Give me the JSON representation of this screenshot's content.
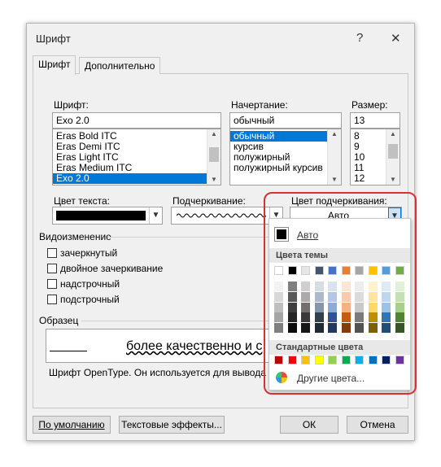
{
  "dialog": {
    "title": "Шрифт",
    "help": "?",
    "close": "✕"
  },
  "tabs": [
    {
      "label": "Шрифт"
    },
    {
      "label": "Дополнительно"
    }
  ],
  "font": {
    "label": "Шрифт:",
    "value": "Exo 2.0",
    "items": [
      "Eras Bold ITC",
      "Eras Demi ITC",
      "Eras Light ITC",
      "Eras Medium ITC",
      "Exo 2.0"
    ],
    "selected": "Exo 2.0"
  },
  "style": {
    "label": "Начертание:",
    "value": "обычный",
    "items": [
      "обычный",
      "курсив",
      "полужирный",
      "полужирный курсив"
    ],
    "selected": "обычный"
  },
  "size": {
    "label": "Размер:",
    "value": "13",
    "items": [
      "8",
      "9",
      "10",
      "11",
      "12"
    ]
  },
  "text_color": {
    "label": "Цвет текста:",
    "value_color": "#000000"
  },
  "underline": {
    "label": "Подчеркивание:"
  },
  "underline_color": {
    "label": "Цвет подчеркивания:",
    "value": "Авто"
  },
  "effects": {
    "heading": "Видоизменение",
    "items": [
      "зачеркнутый",
      "двойное зачеркивание",
      "надстрочный",
      "подстрочный"
    ]
  },
  "sample": {
    "heading": "Образец",
    "preview_text": "более качественно и с",
    "note": "Шрифт OpenType. Он используется для вывода ка"
  },
  "buttons": {
    "default": "По умолчанию",
    "text_effects": "Текстовые эффекты...",
    "ok": "ОК",
    "cancel": "Отмена"
  },
  "color_popup": {
    "auto_label": "Авто",
    "theme_heading": "Цвета темы",
    "standard_heading": "Стандартные цвета",
    "more_colors": "Другие цвета...",
    "theme_top": [
      "#ffffff",
      "#000000",
      "#e7e6e6",
      "#44546a",
      "#4472c4",
      "#ed7d31",
      "#a5a5a5",
      "#ffc000",
      "#5b9bd5",
      "#70ad47"
    ],
    "theme_shades": [
      [
        "#f2f2f2",
        "#7f7f7f",
        "#d0cece",
        "#d6dce4",
        "#d9e2f3",
        "#fbe5d5",
        "#ededed",
        "#fff2cc",
        "#deebf6",
        "#e2efd9"
      ],
      [
        "#d8d8d8",
        "#595959",
        "#aeaaaa",
        "#adb9ca",
        "#b4c6e7",
        "#f7cbac",
        "#dbdbdb",
        "#fee599",
        "#bdd7ee",
        "#c5e0b3"
      ],
      [
        "#bfbfbf",
        "#3f3f3f",
        "#757070",
        "#8496b0",
        "#8eaadb",
        "#f4b183",
        "#c9c9c9",
        "#ffd965",
        "#9cc3e5",
        "#a8d08d"
      ],
      [
        "#a5a5a5",
        "#262626",
        "#3a3838",
        "#323f4f",
        "#2f5496",
        "#c55a11",
        "#7b7b7b",
        "#bf8f00",
        "#2e75b5",
        "#538135"
      ],
      [
        "#7f7f7f",
        "#0c0c0c",
        "#171616",
        "#222a35",
        "#1f3864",
        "#833c0b",
        "#525252",
        "#7f6000",
        "#1e4e79",
        "#375623"
      ]
    ],
    "standard": [
      "#c00000",
      "#ff0000",
      "#ffc000",
      "#ffff00",
      "#92d050",
      "#00b050",
      "#00b0f0",
      "#0070c0",
      "#002060",
      "#7030a0"
    ],
    "highlight_color": "#d8312f"
  }
}
